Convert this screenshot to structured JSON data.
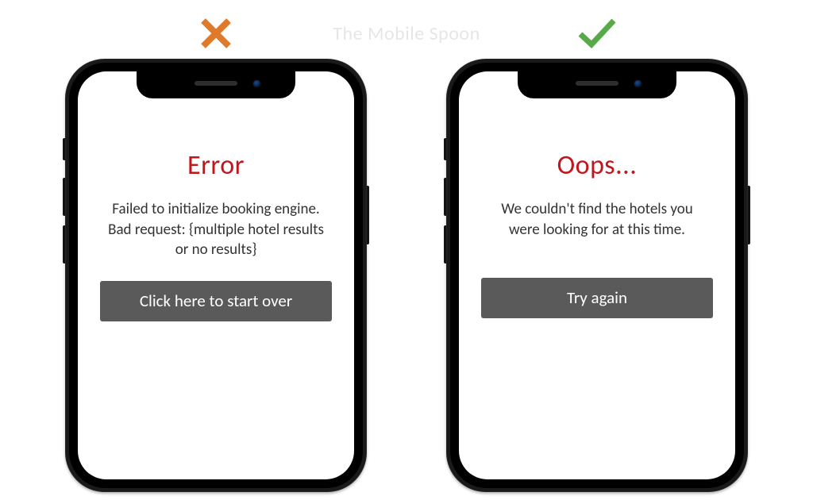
{
  "watermark": "The Mobile Spoon",
  "colors": {
    "cross": "#e07a2b",
    "check": "#58a94a",
    "error_title": "#c0161c",
    "button_bg": "#5a5a5a"
  },
  "bad": {
    "title": "Error",
    "body": "Failed to initialize booking engine. Bad request: {multiple hotel results or no results}",
    "button": "Click here to start over"
  },
  "good": {
    "title": "Oops...",
    "body": "We couldn't find the hotels you were looking for at this time.",
    "button": "Try again"
  }
}
